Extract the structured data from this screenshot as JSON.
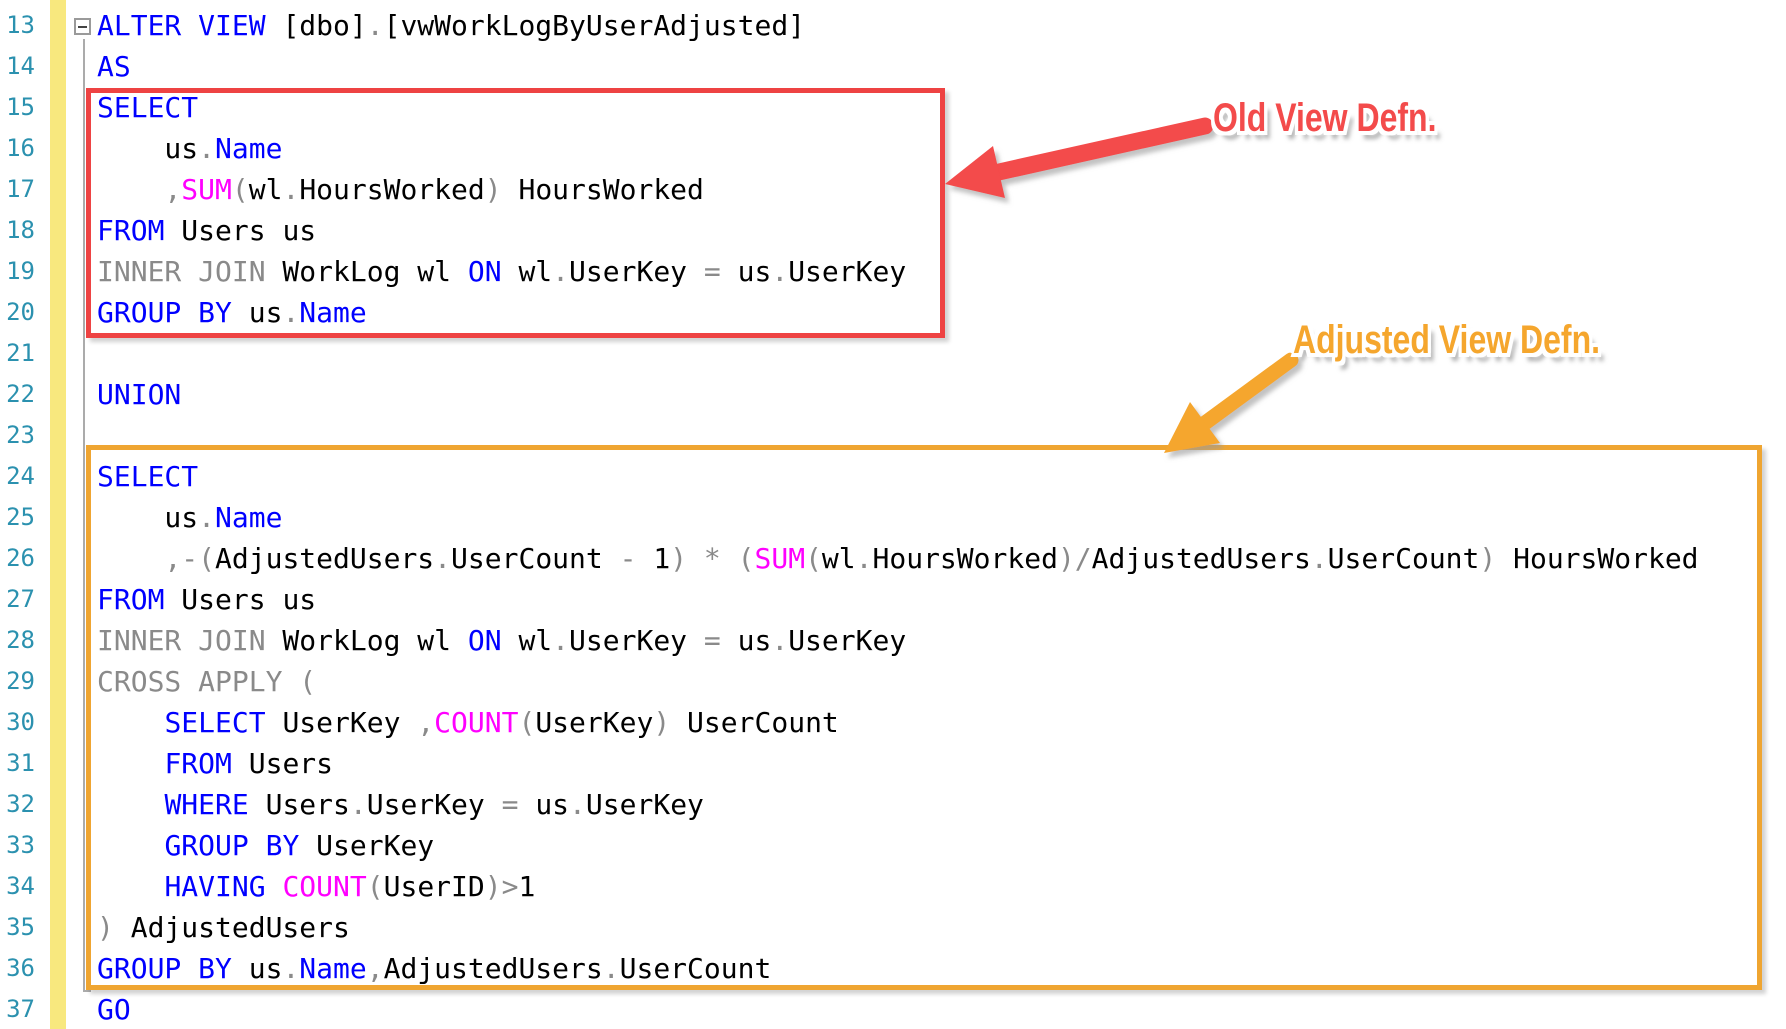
{
  "colors": {
    "keyword": "#0000FF",
    "operator": "#8A8A8A",
    "function": "#FF00FF",
    "identifier": "#000000",
    "line_number": "#2B91AF",
    "change_track_yellow": "#F8E87E",
    "old_box_red": "#EE4343",
    "adjusted_box_orange": "#EFA531",
    "old_label_red": "#F34B4B",
    "adjusted_label_orange": "#F5A62D"
  },
  "annotations": {
    "old": {
      "text": "Old View Defn."
    },
    "adjusted": {
      "text": "Adjusted View Defn."
    }
  },
  "editor": {
    "lines": [
      {
        "n": "13",
        "s": [
          [
            "k",
            "ALTER VIEW "
          ],
          [
            "i",
            "[dbo]"
          ],
          [
            "o",
            "."
          ],
          [
            "i",
            "[vwWorkLogByUserAdjusted]"
          ]
        ]
      },
      {
        "n": "14",
        "s": [
          [
            "k",
            "AS"
          ]
        ]
      },
      {
        "n": "15",
        "s": [
          [
            "k",
            "SELECT"
          ]
        ]
      },
      {
        "n": "16",
        "s": [
          [
            "i",
            "    us"
          ],
          [
            "o",
            "."
          ],
          [
            "k",
            "Name"
          ]
        ]
      },
      {
        "n": "17",
        "s": [
          [
            "i",
            "    "
          ],
          [
            "o",
            ","
          ],
          [
            "f",
            "SUM"
          ],
          [
            "o",
            "("
          ],
          [
            "i",
            "wl"
          ],
          [
            "o",
            "."
          ],
          [
            "i",
            "HoursWorked"
          ],
          [
            "o",
            ")"
          ],
          [
            "i",
            " HoursWorked"
          ]
        ]
      },
      {
        "n": "18",
        "s": [
          [
            "k",
            "FROM"
          ],
          [
            "i",
            " Users us"
          ]
        ]
      },
      {
        "n": "19",
        "s": [
          [
            "o",
            "INNER JOIN"
          ],
          [
            "i",
            " WorkLog wl "
          ],
          [
            "k",
            "ON"
          ],
          [
            "i",
            " wl"
          ],
          [
            "o",
            "."
          ],
          [
            "i",
            "UserKey "
          ],
          [
            "o",
            "="
          ],
          [
            "i",
            " us"
          ],
          [
            "o",
            "."
          ],
          [
            "i",
            "UserKey"
          ]
        ]
      },
      {
        "n": "20",
        "s": [
          [
            "k",
            "GROUP BY"
          ],
          [
            "i",
            " us"
          ],
          [
            "o",
            "."
          ],
          [
            "k",
            "Name"
          ]
        ]
      },
      {
        "n": "21",
        "s": []
      },
      {
        "n": "22",
        "s": [
          [
            "k",
            "UNION"
          ]
        ]
      },
      {
        "n": "23",
        "s": []
      },
      {
        "n": "24",
        "s": [
          [
            "k",
            "SELECT"
          ]
        ]
      },
      {
        "n": "25",
        "s": [
          [
            "i",
            "    us"
          ],
          [
            "o",
            "."
          ],
          [
            "k",
            "Name"
          ]
        ]
      },
      {
        "n": "26",
        "s": [
          [
            "i",
            "    "
          ],
          [
            "o",
            ",-("
          ],
          [
            "i",
            "AdjustedUsers"
          ],
          [
            "o",
            "."
          ],
          [
            "i",
            "UserCount "
          ],
          [
            "o",
            "-"
          ],
          [
            "i",
            " 1"
          ],
          [
            "o",
            ") * ("
          ],
          [
            "f",
            "SUM"
          ],
          [
            "o",
            "("
          ],
          [
            "i",
            "wl"
          ],
          [
            "o",
            "."
          ],
          [
            "i",
            "HoursWorked"
          ],
          [
            "o",
            ")/"
          ],
          [
            "i",
            "AdjustedUsers"
          ],
          [
            "o",
            "."
          ],
          [
            "i",
            "UserCount"
          ],
          [
            "o",
            ")"
          ],
          [
            "i",
            " HoursWorked"
          ]
        ]
      },
      {
        "n": "27",
        "s": [
          [
            "k",
            "FROM"
          ],
          [
            "i",
            " Users us"
          ]
        ]
      },
      {
        "n": "28",
        "s": [
          [
            "o",
            "INNER JOIN"
          ],
          [
            "i",
            " WorkLog wl "
          ],
          [
            "k",
            "ON"
          ],
          [
            "i",
            " wl"
          ],
          [
            "o",
            "."
          ],
          [
            "i",
            "UserKey "
          ],
          [
            "o",
            "="
          ],
          [
            "i",
            " us"
          ],
          [
            "o",
            "."
          ],
          [
            "i",
            "UserKey"
          ]
        ]
      },
      {
        "n": "29",
        "s": [
          [
            "o",
            "CROSS APPLY ("
          ]
        ]
      },
      {
        "n": "30",
        "s": [
          [
            "i",
            "    "
          ],
          [
            "k",
            "SELECT"
          ],
          [
            "i",
            " UserKey "
          ],
          [
            "o",
            ","
          ],
          [
            "f",
            "COUNT"
          ],
          [
            "o",
            "("
          ],
          [
            "i",
            "UserKey"
          ],
          [
            "o",
            ")"
          ],
          [
            "i",
            " UserCount"
          ]
        ]
      },
      {
        "n": "31",
        "s": [
          [
            "i",
            "    "
          ],
          [
            "k",
            "FROM"
          ],
          [
            "i",
            " Users"
          ]
        ]
      },
      {
        "n": "32",
        "s": [
          [
            "i",
            "    "
          ],
          [
            "k",
            "WHERE"
          ],
          [
            "i",
            " Users"
          ],
          [
            "o",
            "."
          ],
          [
            "i",
            "UserKey "
          ],
          [
            "o",
            "="
          ],
          [
            "i",
            " us"
          ],
          [
            "o",
            "."
          ],
          [
            "i",
            "UserKey"
          ]
        ]
      },
      {
        "n": "33",
        "s": [
          [
            "i",
            "    "
          ],
          [
            "k",
            "GROUP BY"
          ],
          [
            "i",
            " UserKey"
          ]
        ]
      },
      {
        "n": "34",
        "s": [
          [
            "i",
            "    "
          ],
          [
            "k",
            "HAVING "
          ],
          [
            "f",
            "COUNT"
          ],
          [
            "o",
            "("
          ],
          [
            "i",
            "UserID"
          ],
          [
            "o",
            ")>"
          ],
          [
            "i",
            "1"
          ]
        ]
      },
      {
        "n": "35",
        "s": [
          [
            "o",
            ")"
          ],
          [
            "i",
            " AdjustedUsers"
          ]
        ]
      },
      {
        "n": "36",
        "s": [
          [
            "k",
            "GROUP BY"
          ],
          [
            "i",
            " us"
          ],
          [
            "o",
            "."
          ],
          [
            "k",
            "Name"
          ],
          [
            "o",
            ","
          ],
          [
            "i",
            "AdjustedUsers"
          ],
          [
            "o",
            "."
          ],
          [
            "i",
            "UserCount"
          ]
        ]
      },
      {
        "n": "37",
        "s": [
          [
            "k",
            "GO"
          ]
        ]
      }
    ]
  }
}
